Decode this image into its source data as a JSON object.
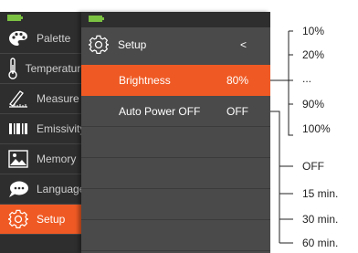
{
  "main_menu": {
    "items": [
      {
        "label": "Palette",
        "icon": "palette-icon"
      },
      {
        "label": "Temperature",
        "icon": "thermometer-icon"
      },
      {
        "label": "Measure",
        "icon": "measure-icon"
      },
      {
        "label": "Emissivity",
        "icon": "emissivity-icon"
      },
      {
        "label": "Memory",
        "icon": "image-icon"
      },
      {
        "label": "Language",
        "icon": "chat-icon"
      },
      {
        "label": "Setup",
        "icon": "gear-icon"
      }
    ],
    "active": "Setup"
  },
  "setup_menu": {
    "title": "Setup",
    "back_label": "<",
    "brightness_label": "Brightness",
    "brightness_value": "80%",
    "auto_power_label": "Auto Power OFF",
    "auto_power_value": "OFF"
  },
  "brightness_options": [
    "10%",
    "20%",
    "...",
    "90%",
    "100%"
  ],
  "auto_power_options": [
    "OFF",
    "15 min.",
    "30 min.",
    "60 min."
  ],
  "colors": {
    "accent": "#ef5a24",
    "battery": "#7bc142",
    "panel_dark": "#2e2e2e",
    "panel": "#4a4a4a"
  }
}
